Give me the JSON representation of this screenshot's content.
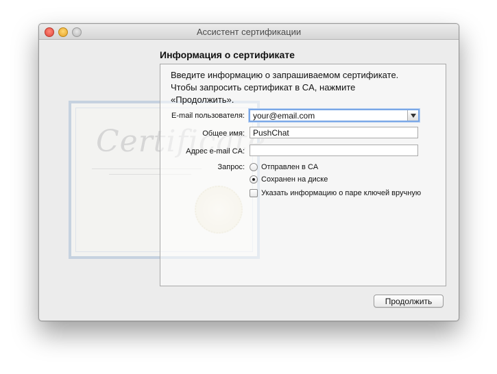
{
  "window": {
    "title": "Ассистент сертификации"
  },
  "artwork": {
    "word": "Certificate"
  },
  "content": {
    "heading": "Информация о сертификате",
    "intro_line1": "Введите информацию о запрашиваемом сертификате.",
    "intro_line2": "Чтобы запросить сертификат в CA, нажмите",
    "intro_line3": "«Продолжить».",
    "fields": {
      "email_label": "E-mail пользователя:",
      "email_value": "your@email.com",
      "name_label": "Общее имя:",
      "name_value": "PushChat",
      "ca_email_label": "Адрес e-mail CA:",
      "ca_email_value": ""
    },
    "request": {
      "label": "Запрос:",
      "option_ca": "Отправлен в CA",
      "option_disk": "Сохранен на диске",
      "selected": "Сохранен на диске",
      "manual_keypair": "Указать информацию о паре ключей вручную",
      "manual_keypair_checked": false
    },
    "continue_button": "Продолжить"
  },
  "colors": {
    "focus_ring": "#7aa7e6",
    "close": "#e0443a",
    "minimize": "#e6a124"
  }
}
